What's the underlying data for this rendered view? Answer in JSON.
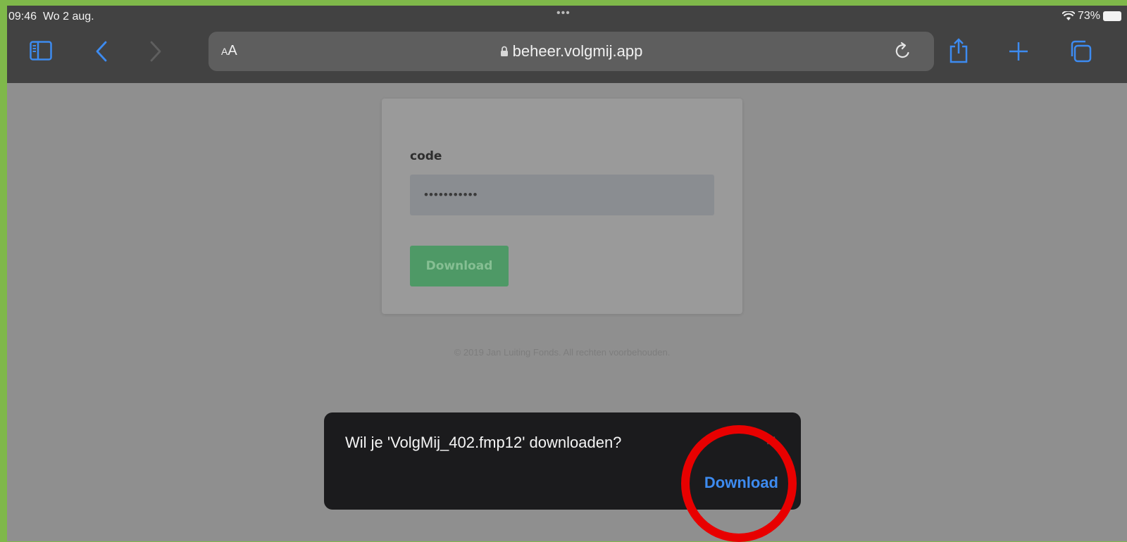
{
  "statusbar": {
    "time": "09:46",
    "date": "Wo 2 aug.",
    "multitask_dots": "•••",
    "battery": "73%"
  },
  "toolbar": {
    "text_size_label_small": "A",
    "text_size_label_large": "A",
    "url": "beheer.volgmij.app"
  },
  "form": {
    "label": "code",
    "input_value": "•••••••••••",
    "button_label": "Download"
  },
  "footer": {
    "text": "© 2019 Jan Luiting Fonds. All rechten voorbehouden."
  },
  "dialog": {
    "message": "Wil je 'VolgMij_402.fmp12' downloaden?",
    "close_glyph": "✕",
    "download_label": "Download"
  },
  "colors": {
    "frame": "#7fb84a",
    "toolbar": "#424242",
    "accent": "#3d8bf0",
    "highlight": "#e80000",
    "button_green": "#4e9966"
  }
}
